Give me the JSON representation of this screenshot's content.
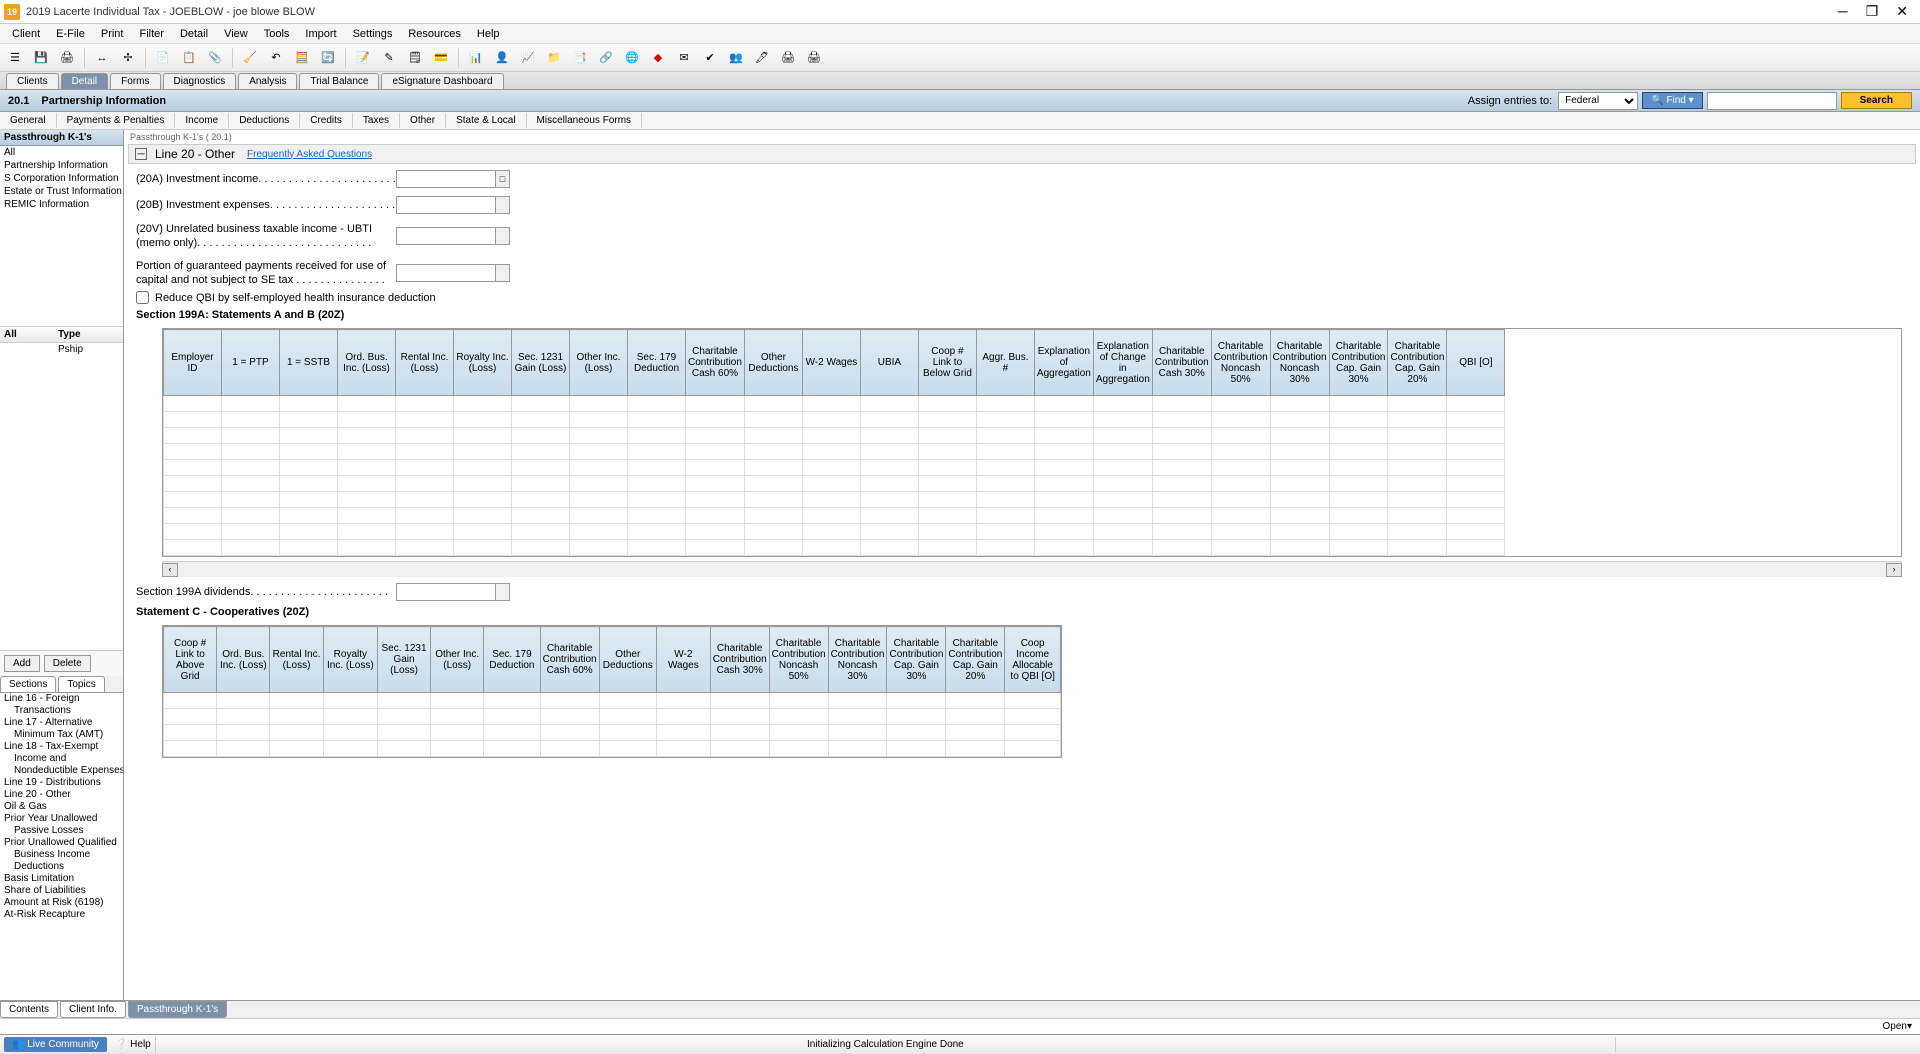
{
  "window": {
    "title": "2019 Lacerte Individual Tax - JOEBLOW - joe blowe BLOW"
  },
  "menu": [
    "Client",
    "E-File",
    "Print",
    "Filter",
    "Detail",
    "View",
    "Tools",
    "Import",
    "Settings",
    "Resources",
    "Help"
  ],
  "main_tabs": [
    "Clients",
    "Detail",
    "Forms",
    "Diagnostics",
    "Analysis",
    "Trial Balance",
    "eSignature Dashboard"
  ],
  "header": {
    "code": "20.1",
    "title": "Partnership Information",
    "assign_label": "Assign entries to:",
    "assign_value": "Federal",
    "find_label": "Find ▾",
    "search_label": "Search"
  },
  "subtabs": [
    "General",
    "Payments & Penalties",
    "Income",
    "Deductions",
    "Credits",
    "Taxes",
    "Other",
    "State & Local",
    "Miscellaneous Forms"
  ],
  "left": {
    "top_header": "Passthrough K-1's",
    "top_items": [
      "All",
      "Partnership Information",
      "S Corporation Information",
      "Estate or Trust Information",
      "REMIC Information"
    ],
    "grid_cols": [
      "All",
      "Type"
    ],
    "grid_row_type": "Pship",
    "add": "Add",
    "delete": "Delete",
    "tabs2": [
      "Sections",
      "Topics"
    ],
    "sections": [
      "Line 16 - Foreign",
      "  Transactions",
      "Line 17 - Alternative",
      "  Minimum Tax (AMT)",
      "Line 18 - Tax-Exempt",
      "  Income and",
      "  Nondeductible Expenses",
      "Line 19 - Distributions",
      "Line 20 - Other",
      "Oil & Gas",
      "Prior Year Unallowed",
      "  Passive Losses",
      "Prior Unallowed Qualified",
      "  Business Income",
      "  Deductions",
      "Basis Limitation",
      "Share of Liabilities",
      "Amount at Risk (6198)",
      "At-Risk Recapture"
    ]
  },
  "content": {
    "crumb": "Passthrough K-1's  ( 20.1)",
    "section_title": "Line 20 - Other",
    "faq": "Frequently Asked Questions",
    "fields": {
      "f20a": "(20A) Investment income. . . . . . . . . . . . . . . . . . . . . . .",
      "f20b": "(20B) Investment expenses. . . . . . . . . . . . . . . . . . . . .",
      "f20v": "(20V) Unrelated business taxable income - UBTI (memo only). . . . . . . . . . . . . . . . . . . . . . . . . . . . .",
      "portion": "Portion of guaranteed payments received for use of capital and not subject to SE tax . . . . . . . . . . . . . . .",
      "checkbox": "Reduce QBI by self-employed health insurance deduction",
      "sec199a_hdr": "Section 199A: Statements A and B (20Z)",
      "dividends": "Section 199A dividends. . . . . . . . . . . . . . . . . . . . . . .",
      "stmtc_hdr": "Statement C - Cooperatives (20Z)"
    },
    "grid1_cols": [
      "Employer ID",
      "1 = PTP",
      "1 = SSTB",
      "Ord. Bus. Inc. (Loss)",
      "Rental Inc. (Loss)",
      "Royalty Inc. (Loss)",
      "Sec. 1231 Gain (Loss)",
      "Other Inc. (Loss)",
      "Sec. 179 Deduction",
      "Charitable Contribution Cash 60%",
      "Other Deductions",
      "W-2 Wages",
      "UBIA",
      "Coop # Link to Below Grid",
      "Aggr. Bus. #",
      "Explanation of Aggregation",
      "Explanation of Change in Aggregation",
      "Charitable Contribution Cash 30%",
      "Charitable Contribution Noncash 50%",
      "Charitable Contribution Noncash 30%",
      "Charitable Contribution Cap. Gain 30%",
      "Charitable Contribution Cap. Gain 20%",
      "QBI [O]"
    ],
    "grid2_cols": [
      "Coop # Link to Above Grid",
      "Ord. Bus. Inc. (Loss)",
      "Rental Inc. (Loss)",
      "Royalty Inc. (Loss)",
      "Sec. 1231 Gain (Loss)",
      "Other Inc. (Loss)",
      "Sec. 179 Deduction",
      "Charitable Contribution Cash 60%",
      "Other Deductions",
      "W-2 Wages",
      "Charitable Contribution Cash 30%",
      "Charitable Contribution Noncash 50%",
      "Charitable Contribution Noncash 30%",
      "Charitable Contribution Cap. Gain 30%",
      "Charitable Contribution Cap. Gain 20%",
      "Coop Income Allocable to QBI [O]"
    ]
  },
  "bottom_tabs": [
    "Contents",
    "Client Info.",
    "Passthrough K-1's"
  ],
  "open_label": "Open▾",
  "status": {
    "live": "Live Community",
    "help": "Help",
    "center": "Initializing Calculation Engine Done"
  }
}
